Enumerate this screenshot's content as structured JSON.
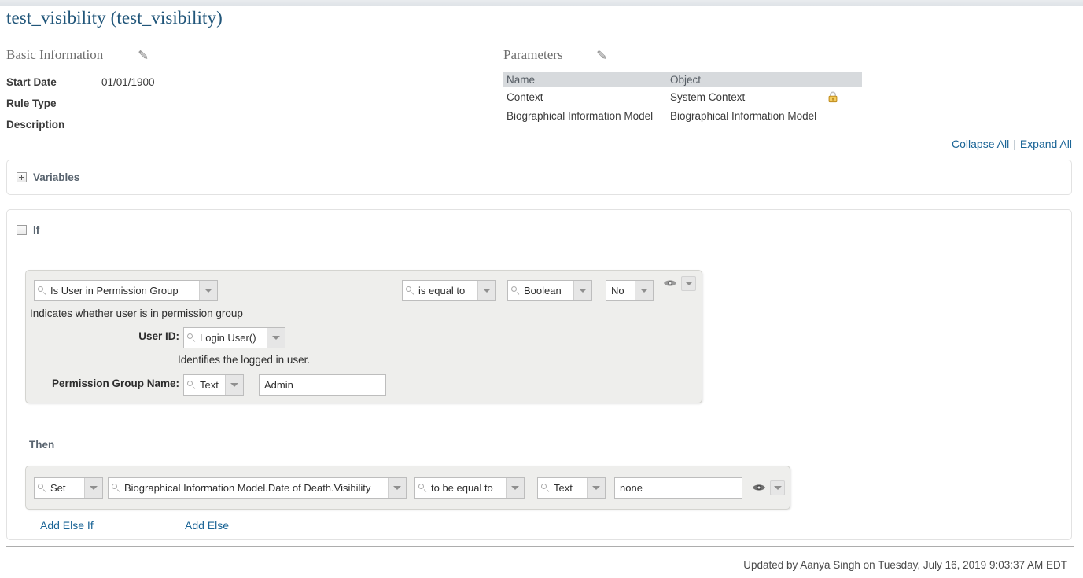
{
  "page": {
    "title": "test_visibility (test_visibility)"
  },
  "basic_information": {
    "heading": "Basic Information",
    "edit_icon": "pencil-icon",
    "fields": [
      {
        "label": "Start Date",
        "value": "01/01/1900"
      },
      {
        "label": "Rule Type",
        "value": ""
      },
      {
        "label": "Description",
        "value": ""
      }
    ]
  },
  "parameters": {
    "heading": "Parameters",
    "edit_icon": "pencil-icon",
    "columns": [
      "Name",
      "Object"
    ],
    "rows": [
      {
        "name": "Context",
        "object": "System Context",
        "locked": true,
        "lock_icon": "lock-icon"
      },
      {
        "name": "Biographical Information Model",
        "object": "Biographical Information Model",
        "locked": false,
        "lock_icon": ""
      }
    ]
  },
  "toolbar": {
    "collapse_all": "Collapse All",
    "separator": "|",
    "expand_all": "Expand All"
  },
  "variables_panel": {
    "label": "Variables",
    "toggle_icon": "plus-box-icon",
    "expanded": false
  },
  "if_panel": {
    "label": "If",
    "toggle_icon": "minus-box-icon",
    "expanded": true,
    "condition": {
      "function": {
        "value": "Is User in Permission Group",
        "search_icon": "search-icon",
        "arrow_icon": "chevron-down-icon"
      },
      "operator": {
        "value": "is equal to",
        "search_icon": "search-icon",
        "arrow_icon": "chevron-down-icon"
      },
      "value_type": {
        "value": "Boolean",
        "search_icon": "search-icon",
        "arrow_icon": "chevron-down-icon"
      },
      "value": {
        "value": "No",
        "arrow_icon": "chevron-down-icon"
      },
      "visibility_icon": "eye-icon",
      "menu_icon": "chevron-down-icon",
      "description": "Indicates whether user is in permission group",
      "params": [
        {
          "label": "User ID:",
          "selector": {
            "value": "Login User()",
            "search_icon": "search-icon",
            "arrow_icon": "chevron-down-icon"
          },
          "hint": "Identifies the logged in user.",
          "text_value": null
        },
        {
          "label": "Permission Group Name:",
          "selector": {
            "value": "Text",
            "search_icon": "search-icon",
            "arrow_icon": "chevron-down-icon"
          },
          "hint": "",
          "text_value": "Admin"
        }
      ]
    },
    "then": {
      "label": "Then",
      "action": {
        "value": "Set",
        "search_icon": "search-icon",
        "arrow_icon": "chevron-down-icon"
      },
      "target": {
        "value": "Biographical Information Model.Date of Death.Visibility",
        "search_icon": "search-icon",
        "arrow_icon": "chevron-down-icon"
      },
      "operator": {
        "value": "to be equal to",
        "search_icon": "search-icon",
        "arrow_icon": "chevron-down-icon"
      },
      "value_type": {
        "value": "Text",
        "search_icon": "search-icon",
        "arrow_icon": "chevron-down-icon"
      },
      "value": "none",
      "visibility_icon": "eye-icon",
      "menu_icon": "chevron-down-icon"
    },
    "actions": {
      "add_else_if": "Add Else If",
      "add_else": "Add Else"
    }
  },
  "footer": {
    "updated_text": "Updated by Aanya Singh on Tuesday, July 16, 2019 9:03:37 AM EDT"
  },
  "colors": {
    "link": "#1a6496",
    "title": "#21567a",
    "panel_bg": "#eeeeec",
    "table_header": "#d7dadd",
    "lock": "#e8b63a"
  }
}
